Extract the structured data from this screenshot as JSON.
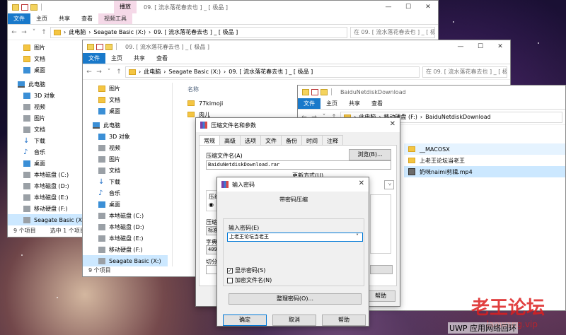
{
  "win1": {
    "title": "09. [ 流水落花春去也 ] _ [ 极品 ]",
    "tabs": [
      "文件",
      "主页",
      "共享",
      "查看"
    ],
    "context_tab": "视频工具",
    "context_group": "播放",
    "path": [
      "此电脑",
      "Seagate Basic (X:)",
      "09. [ 流水落花春去也 ] _ [ 极品 ]"
    ],
    "search": "在 09. [ 流水落花春去也 ] _ [ 极品 ] 中搜索",
    "nav": [
      "图片",
      "文档",
      "桌面",
      "此电脑",
      "3D 对象",
      "视频",
      "图片",
      "文档",
      "下载",
      "音乐",
      "桌面",
      "本地磁盘 (C:)",
      "本地磁盘 (D:)",
      "本地磁盘 (E:)",
      "移动硬盘 (F:)",
      "Seagate Basic (X:)"
    ],
    "status": [
      "9 个项目",
      "选中 1 个项目"
    ]
  },
  "win2": {
    "title": "09. [ 流水落花春去也 ] _ [ 极品 ]",
    "tabs": [
      "文件",
      "主页",
      "共享",
      "查看"
    ],
    "path": [
      "此电脑",
      "Seagate Basic (X:)",
      "09. [ 流水落花春去也 ] _ [ 极品 ]"
    ],
    "search": "在 09. [ 流水落花春去也 ] _ [ 极品 ] 中搜索",
    "nav": [
      "图片",
      "文档",
      "桌面",
      "此电脑",
      "3D 对象",
      "视频",
      "图片",
      "文档",
      "下载",
      "音乐",
      "桌面",
      "本地磁盘 (C:)",
      "本地磁盘 (D:)",
      "本地磁盘 (E:)",
      "移动硬盘 (F:)",
      "Seagate Basic (X:)"
    ],
    "col_name": "名称",
    "files": [
      "77kimoji",
      "肉儿"
    ],
    "status": "9 个项目"
  },
  "win3": {
    "title": "BaiduNetdiskDownload",
    "tabs": [
      "文件",
      "主页",
      "共享",
      "查看"
    ],
    "path": [
      "此电脑",
      "移动硬盘 (F:)",
      "BaiduNetdiskDownload"
    ],
    "search": "在 BaiduNetdiskDownload 中搜索",
    "files": [
      {
        "name": "__MACOSX",
        "type": "folder"
      },
      {
        "name": "上老王论坛当老王",
        "type": "folder"
      },
      {
        "name": "奶咪naimi剪辑.mp4",
        "type": "mp4"
      }
    ]
  },
  "archive_dialog": {
    "title": "压缩文件名和参数",
    "tabs": [
      "常规",
      "高级",
      "选项",
      "文件",
      "备份",
      "时间",
      "注释"
    ],
    "filename_label": "压缩文件名(A)",
    "filename_value": "BaiduNetdiskDownload.rar",
    "browse": "浏览(B)...",
    "update_label": "更新方式(U)",
    "format_label_partial": "压缩",
    "method_label_partial": "压缩",
    "method_value_partial": "标准",
    "dict_label_partial": "字典",
    "dict_value_partial": "4096",
    "split_label_partial": "切分",
    "help": "帮助"
  },
  "password_dialog": {
    "title": "输入密码",
    "heading": "带密码压缩",
    "input_label": "输入密码(E)",
    "password_value": "上老王论坛当老王",
    "show_password": "显示密码(S)",
    "encrypt_names": "加密文件名(N)",
    "organize": "整理密码(O)...",
    "ok": "确定",
    "cancel": "取消",
    "help": "帮助",
    "show_password_checked": true,
    "encrypt_names_checked": false
  },
  "watermark": {
    "line1": "老王论坛",
    "line2": "laowang.vip"
  },
  "taskbar_text": "UWP 应用网络回环"
}
